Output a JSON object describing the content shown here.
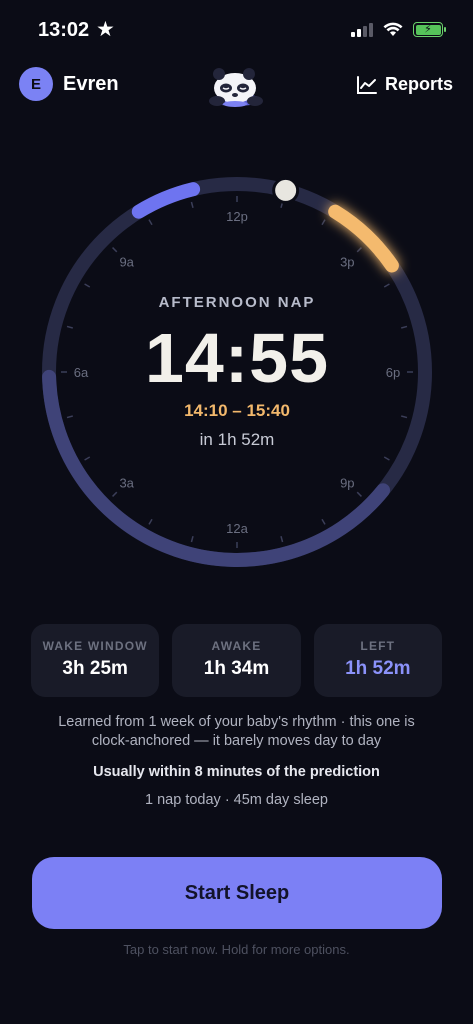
{
  "status_bar": {
    "time": "13:02",
    "star_icon": "star-icon",
    "icons": [
      "signal-icon",
      "wifi-icon",
      "battery-charging-icon"
    ]
  },
  "header": {
    "avatar_initial": "E",
    "profile_name": "Evren",
    "logo_icon": "sleeping-panda-logo",
    "reports_label": "Reports",
    "reports_icon": "chart-line-icon"
  },
  "dial": {
    "hour_labels": [
      "12p",
      "3p",
      "6p",
      "9p",
      "12a",
      "3a",
      "6a",
      "9a"
    ],
    "nap_label": "AFTERNOON NAP",
    "nap_time": "14:55",
    "nap_range": "14:10 – 15:40",
    "countdown": "in 1h 52m",
    "colors": {
      "track": "#2a2d4a",
      "sleep_arc": "#3f4378",
      "recent_sleep": "#6e74f0",
      "nap_window": "#f4ba6e",
      "now_marker": "#e8e6e0"
    }
  },
  "stats": [
    {
      "label": "WAKE WINDOW",
      "value": "3h 25m"
    },
    {
      "label": "AWAKE",
      "value": "1h 34m"
    },
    {
      "label": "LEFT",
      "value": "1h 52m"
    }
  ],
  "info": {
    "learned_line1": "Learned from 1 week of your baby's rhythm · this one is",
    "learned_line2": "clock-anchored — it barely moves day to day",
    "usually": "Usually within 8 minutes of the prediction",
    "today": "1 nap today · 45m day sleep"
  },
  "cta": {
    "label": "Start Sleep",
    "hint": "Tap to start now. Hold for more options."
  }
}
